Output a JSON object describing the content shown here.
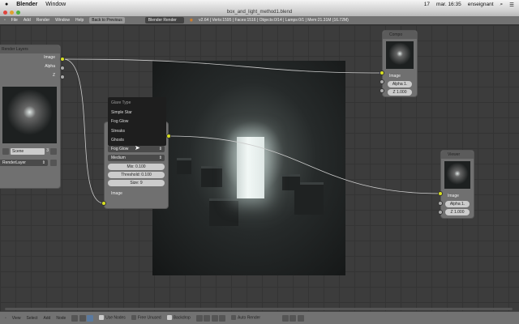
{
  "menubar": {
    "app": "Blender",
    "window": "Window",
    "status_indicator": "17",
    "clock": "mar. 16:35",
    "user": "enseignant"
  },
  "titlebar": {
    "title": "box_and_light_method1.blend"
  },
  "header": {
    "menus": [
      "File",
      "Add",
      "Render",
      "Window",
      "Help"
    ],
    "back_button": "Back to Previous",
    "engine": "Blender Render",
    "stats": "v2.64 | Verts:1595 | Faces:1516 | Objects:0/14 | Lamps:0/1 | Mem:21.31M (16.72M)"
  },
  "render_layers": {
    "title": "Render Layers",
    "outputs": [
      "Image",
      "Alpha",
      "Z"
    ],
    "scene": "Scene",
    "scene_users": "3",
    "layer": "RenderLayer"
  },
  "glare": {
    "menu_title": "Glare Type",
    "menu_items": [
      "Simple Star",
      "Fog Glow",
      "Streaks",
      "Ghosts"
    ],
    "type": "Fog Glow",
    "quality": "Medium",
    "mix": "Mix: 0.100",
    "threshold": "Threshold: 0.100",
    "size": "Size: 9",
    "input": "Image"
  },
  "composite": {
    "title": "Compo",
    "input": "Image",
    "alpha": "Alpha 1.",
    "z": "Z 1.000"
  },
  "viewer": {
    "title": "Viewer",
    "input": "Image",
    "alpha": "Alpha 1.",
    "z": "Z 1.000"
  },
  "footer": {
    "menus": [
      "View",
      "Select",
      "Add",
      "Node"
    ],
    "use_nodes": "Use Nodes",
    "free_unused": "Free Unused",
    "backdrop": "Backdrop",
    "auto_render": "Auto Render"
  }
}
